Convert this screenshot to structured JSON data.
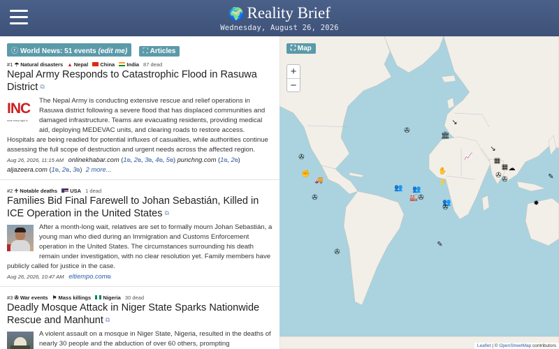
{
  "header": {
    "title": "Reality Brief",
    "date": "Wednesday, August 26, 2026"
  },
  "toolbar": {
    "world_news_label": "World News: 51 events",
    "edit_label": "(edit me)",
    "articles_label": "Articles"
  },
  "articles": [
    {
      "index": "#1",
      "tags": [
        "Natural disasters",
        "Nepal",
        "China",
        "India"
      ],
      "dead": "87 dead",
      "title": "Nepal Army Responds to Catastrophic Flood in Rasuwa District",
      "thumb_text": "INC",
      "thumb_tag": "more every night is",
      "summary": "The Nepal Army is conducting extensive rescue and relief operations in Rasuwa district following a severe flood that has displaced communities and damaged infrastructure. Teams are evacuating residents, providing medical aid, deploying MEDEVAC units, and clearing roads to restore access. Hospitals are being readied for potential influxes of casualties, while authorities continue assessing the full scope of destruction and urgent needs across the affected region.",
      "date": "Aug 26, 2026, 11:15 AM",
      "sources": [
        {
          "name": "onlinekhabar.com",
          "links": [
            "1",
            "2",
            "3",
            "4",
            "5"
          ]
        },
        {
          "name": "punchng.com",
          "links": [
            "1",
            "2"
          ]
        },
        {
          "name": "aljazeera.com",
          "links": [
            "1",
            "2",
            "3"
          ]
        }
      ],
      "more": "2 more..."
    },
    {
      "index": "#2",
      "tags": [
        "Notable deaths",
        "USA"
      ],
      "dead": "1 dead",
      "title": "Families Bid Final Farewell to Johan Sebastián, Killed in ICE Operation in the United States",
      "summary": "After a month-long wait, relatives are set to formally mourn Johan Sebastián, a young man who died during an Immigration and Customs Enforcement operation in the United States. The circumstances surrounding his death remain under investigation, with no clear resolution yet. Family members have publicly called for justice in the case.",
      "date": "Aug 26, 2026, 10:47 AM",
      "sources": [
        {
          "name": "eltiempo.com"
        }
      ]
    },
    {
      "index": "#3",
      "tags": [
        "War events",
        "Mass killings",
        "Nigeria"
      ],
      "dead": "30 dead",
      "title": "Deadly Mosque Attack in Niger State Sparks Nationwide Rescue and Manhunt",
      "summary": "A violent assault on a mosque in Niger State, Nigeria, resulted in the deaths of nearly 30 people and the abduction of over 60 others, prompting"
    }
  ],
  "map": {
    "label": "Map",
    "zoom_in": "+",
    "zoom_out": "−",
    "attribution_leaflet": "Leaflet",
    "attribution_sep": " | © ",
    "attribution_osm": "OpenStreetMap",
    "attribution_suffix": " contributors"
  },
  "icons": {
    "globe": "🌍",
    "tag_disaster": "☂",
    "tag_deaths": "♱",
    "tag_war": "✇",
    "tag_killings": "⚑",
    "external": "⧉"
  },
  "colors": {
    "header": "#4a6089",
    "accent": "#5b9aa9",
    "ocean": "#aad3df",
    "land": "#f2efe9",
    "link": "#2a5ea8"
  }
}
